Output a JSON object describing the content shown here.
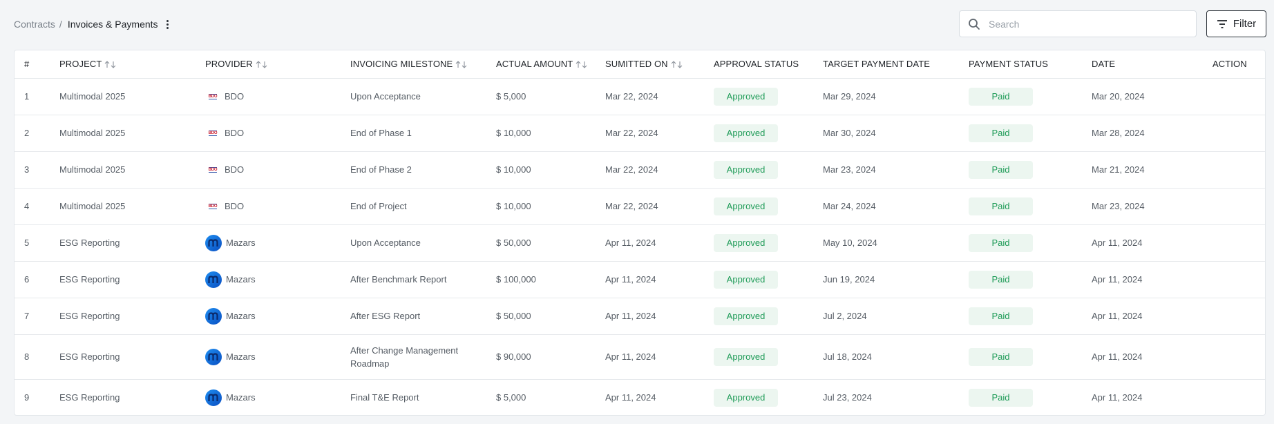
{
  "breadcrumb": {
    "parent": "Contracts",
    "separator": "/",
    "current": "Invoices & Payments"
  },
  "search": {
    "placeholder": "Search",
    "value": ""
  },
  "filter": {
    "label": "Filter"
  },
  "colors": {
    "approved_text": "#1e9b57",
    "badge_bg": "#ecf6f0",
    "mazars_blue": "#1f8ef0",
    "bdo_red": "#cc2233"
  },
  "table": {
    "columns": {
      "index": "#",
      "project": "PROJECT",
      "provider": "PROVIDER",
      "milestone": "INVOICING MILESTONE",
      "amount": "ACTUAL AMOUNT",
      "submitted": "SUMITTED ON",
      "approval": "APPROVAL STATUS",
      "target": "TARGET PAYMENT DATE",
      "payment": "PAYMENT STATUS",
      "date": "DATE",
      "action": "ACTION"
    },
    "rows": [
      {
        "index": "1",
        "project": "Multimodal 2025",
        "provider": "BDO",
        "logo": "bdo-logo-icon",
        "logo_text": "BDO",
        "milestone": "Upon Acceptance",
        "amount": "$ 5,000",
        "submitted": "Mar 22, 2024",
        "approval": "Approved",
        "target": "Mar 29, 2024",
        "payment": "Paid",
        "date": "Mar 20, 2024"
      },
      {
        "index": "2",
        "project": "Multimodal 2025",
        "provider": "BDO",
        "logo": "bdo-logo-icon",
        "logo_text": "BDO",
        "milestone": "End of Phase 1",
        "amount": "$ 10,000",
        "submitted": "Mar 22, 2024",
        "approval": "Approved",
        "target": "Mar 30, 2024",
        "payment": "Paid",
        "date": "Mar 28, 2024"
      },
      {
        "index": "3",
        "project": "Multimodal 2025",
        "provider": "BDO",
        "logo": "bdo-logo-icon",
        "logo_text": "BDO",
        "milestone": "End of Phase 2",
        "amount": "$ 10,000",
        "submitted": "Mar 22, 2024",
        "approval": "Approved",
        "target": "Mar 23, 2024",
        "payment": "Paid",
        "date": "Mar 21, 2024"
      },
      {
        "index": "4",
        "project": "Multimodal 2025",
        "provider": "BDO",
        "logo": "bdo-logo-icon",
        "logo_text": "BDO",
        "milestone": "End of Project",
        "amount": "$ 10,000",
        "submitted": "Mar 22, 2024",
        "approval": "Approved",
        "target": "Mar 24, 2024",
        "payment": "Paid",
        "date": "Mar 23, 2024"
      },
      {
        "index": "5",
        "project": "ESG Reporting",
        "provider": "Mazars",
        "logo": "mazars-logo-icon",
        "milestone": "Upon Acceptance",
        "amount": "$ 50,000",
        "submitted": "Apr 11, 2024",
        "approval": "Approved",
        "target": "May 10, 2024",
        "payment": "Paid",
        "date": "Apr 11, 2024"
      },
      {
        "index": "6",
        "project": "ESG Reporting",
        "provider": "Mazars",
        "logo": "mazars-logo-icon",
        "milestone": "After Benchmark Report",
        "amount": "$ 100,000",
        "submitted": "Apr 11, 2024",
        "approval": "Approved",
        "target": "Jun 19, 2024",
        "payment": "Paid",
        "date": "Apr 11, 2024"
      },
      {
        "index": "7",
        "project": "ESG Reporting",
        "provider": "Mazars",
        "logo": "mazars-logo-icon",
        "milestone": "After ESG Report",
        "amount": "$ 50,000",
        "submitted": "Apr 11, 2024",
        "approval": "Approved",
        "target": "Jul 2, 2024",
        "payment": "Paid",
        "date": "Apr 11, 2024"
      },
      {
        "index": "8",
        "project": "ESG Reporting",
        "provider": "Mazars",
        "logo": "mazars-logo-icon",
        "milestone": "After Change Management Roadmap",
        "amount": "$ 90,000",
        "submitted": "Apr 11, 2024",
        "approval": "Approved",
        "target": "Jul 18, 2024",
        "payment": "Paid",
        "date": "Apr 11, 2024"
      },
      {
        "index": "9",
        "project": "ESG Reporting",
        "provider": "Mazars",
        "logo": "mazars-logo-icon",
        "milestone": "Final T&E Report",
        "amount": "$ 5,000",
        "submitted": "Apr 11, 2024",
        "approval": "Approved",
        "target": "Jul 23, 2024",
        "payment": "Paid",
        "date": "Apr 11, 2024"
      }
    ]
  }
}
